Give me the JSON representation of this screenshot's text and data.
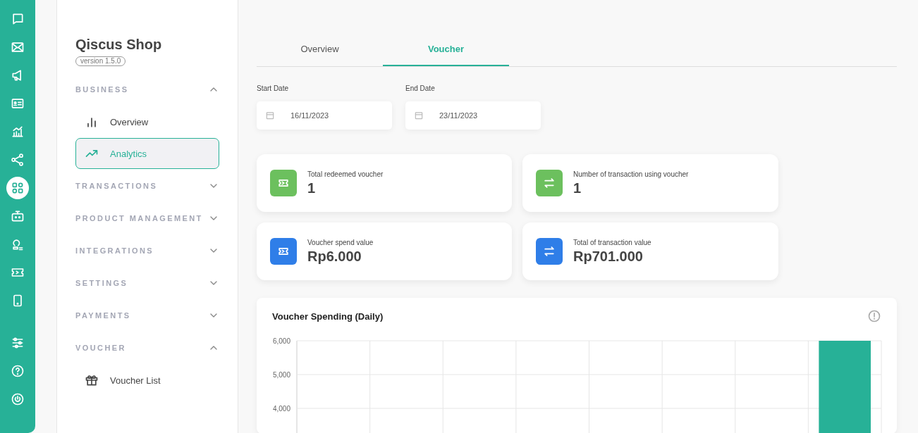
{
  "rail": {
    "items": [
      {
        "selected": false
      },
      {
        "selected": false
      },
      {
        "selected": false
      },
      {
        "selected": false
      },
      {
        "selected": false
      },
      {
        "selected": false
      },
      {
        "selected": true
      },
      {
        "selected": false
      },
      {
        "selected": false
      },
      {
        "selected": false
      },
      {
        "selected": false
      },
      {
        "selected": false
      },
      {
        "selected": false
      },
      {
        "selected": false
      }
    ]
  },
  "sidebar": {
    "title": "Qiscus Shop",
    "version": "version 1.5.0",
    "sections": [
      {
        "label": "BUSINESS",
        "expanded": true,
        "items": [
          {
            "label": "Overview",
            "selected": false
          },
          {
            "label": "Analytics",
            "selected": true
          }
        ]
      },
      {
        "label": "TRANSACTIONS",
        "expanded": false
      },
      {
        "label": "PRODUCT MANAGEMENT",
        "expanded": false
      },
      {
        "label": "INTEGRATIONS",
        "expanded": false
      },
      {
        "label": "SETTINGS",
        "expanded": false
      },
      {
        "label": "PAYMENTS",
        "expanded": false
      },
      {
        "label": "VOUCHER",
        "expanded": true,
        "items": [
          {
            "label": "Voucher List",
            "selected": false
          }
        ]
      }
    ]
  },
  "tabs": [
    {
      "label": "Overview",
      "selected": false
    },
    {
      "label": "Voucher",
      "selected": true
    }
  ],
  "date_range": [
    {
      "label": "Start Date",
      "value": "16/11/2023"
    },
    {
      "label": "End Date",
      "value": "23/11/2023"
    }
  ],
  "stats": [
    {
      "label": "Total redeemed voucher",
      "value": "1",
      "kind": "voucher",
      "color": "#6cc05e"
    },
    {
      "label": "Number of transaction using voucher",
      "value": "1",
      "kind": "transfer",
      "color": "#6cc05e"
    },
    {
      "label": "Voucher spend value",
      "value": "Rp6.000",
      "kind": "voucher",
      "color": "#2f7ee8"
    },
    {
      "label": "Total of transaction value",
      "value": "Rp701.000",
      "kind": "transfer",
      "color": "#2f7ee8"
    }
  ],
  "chart": {
    "title": "Voucher Spending (Daily)",
    "chart_data": {
      "type": "bar",
      "ylim": [
        0,
        6000
      ],
      "yticks": [
        {
          "value": 4000,
          "label": "4,000"
        },
        {
          "value": 5000,
          "label": "5,000"
        },
        {
          "value": 6000,
          "label": "6,000"
        }
      ],
      "values": [
        null,
        null,
        null,
        null,
        null,
        null,
        null,
        6000
      ]
    }
  }
}
